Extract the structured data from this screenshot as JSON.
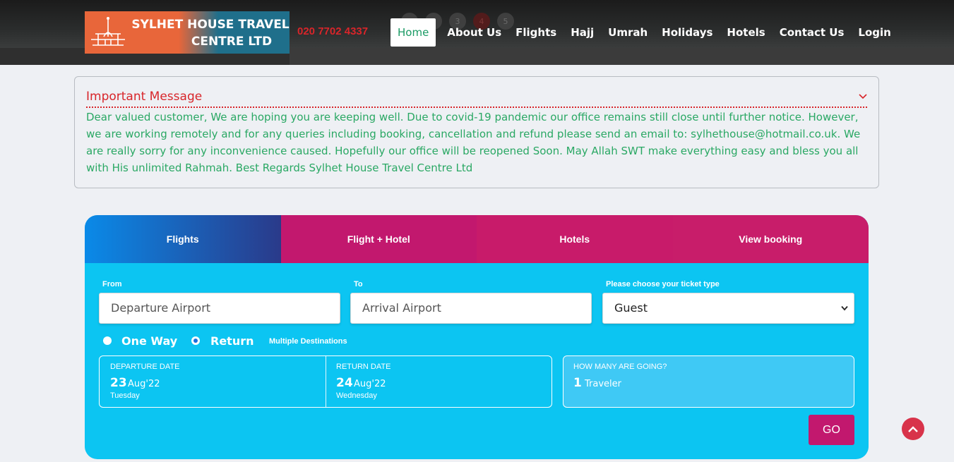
{
  "brand": {
    "line1": "SYLHET HOUSE TRAVEL",
    "line2": "CENTRE LTD",
    "phone": "020 7702 4337"
  },
  "slider_dots": [
    "1",
    "2",
    "3",
    "4",
    "5"
  ],
  "nav": [
    {
      "label": "Home",
      "active": true
    },
    {
      "label": "About Us"
    },
    {
      "label": "Flights"
    },
    {
      "label": "Hajj"
    },
    {
      "label": "Umrah"
    },
    {
      "label": "Holidays"
    },
    {
      "label": "Hotels"
    },
    {
      "label": "Contact Us"
    },
    {
      "label": "Login"
    }
  ],
  "message": {
    "title": "Important Message",
    "body": "Dear valued customer, We are hoping you are keeping well. Due to covid-19 pandemic our office remains still close until further notice. However, we are working remotely and for any queries including booking, cancellation and refund please send an email to: sylhethouse@hotmail.co.uk. We are really sorry for any inconvenience caused. Hopefully our office will be reopened Soon. May Allah SWT make everything easy and bless you all with His unlimited Rahmah. Best Regards Sylhet House Travel Centre Ltd"
  },
  "booking": {
    "tabs": [
      "Flights",
      "Flight + Hotel",
      "Hotels",
      "View booking"
    ],
    "from_label": "From",
    "from_placeholder": "Departure Airport",
    "to_label": "To",
    "to_placeholder": "Arrival Airport",
    "ticket_label": "Please choose your ticket type",
    "ticket_value": "Guest",
    "one_way": "One Way",
    "return": "Return",
    "selected_trip": "Return",
    "multiple": "Multiple Destinations",
    "departure": {
      "label": "DEPARTURE DATE",
      "day": "23",
      "month": "Aug'22",
      "weekday": "Tuesday"
    },
    "return_date": {
      "label": "RETURN DATE",
      "day": "24",
      "month": "Aug'22",
      "weekday": "Wednesday"
    },
    "travelers": {
      "label": "HOW MANY ARE GOING?",
      "count": "1",
      "unit": "Traveler"
    },
    "go": "GO"
  },
  "colors": {
    "accent": "#c2186e",
    "widget": "#0cc5f2",
    "message_text": "#2aa864",
    "alert": "#d8252a"
  }
}
